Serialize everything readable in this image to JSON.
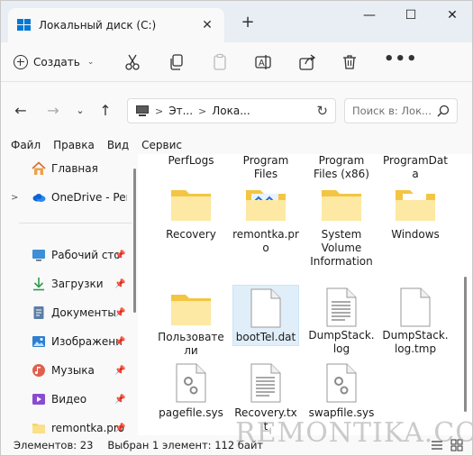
{
  "tab": {
    "title": "Локальный диск (C:)"
  },
  "window_controls": {
    "minimize": "—",
    "maximize": "☐",
    "close": "✕"
  },
  "toolbar": {
    "create_label": "Создать",
    "more_label": "•••"
  },
  "address": {
    "crumbs": [
      "Эт...",
      "Лока..."
    ]
  },
  "search": {
    "placeholder": "Поиск в: Лок..."
  },
  "menu": [
    "Файл",
    "Правка",
    "Вид",
    "Сервис"
  ],
  "nav": {
    "items": [
      {
        "label": "Главная",
        "icon": "home-icon"
      },
      {
        "label": "OneDrive - Perso",
        "icon": "onedrive-icon"
      },
      {
        "label": "Рабочий сто",
        "icon": "desktop-icon"
      },
      {
        "label": "Загрузки",
        "icon": "download-icon"
      },
      {
        "label": "Документы",
        "icon": "documents-icon"
      },
      {
        "label": "Изображени",
        "icon": "pictures-icon"
      },
      {
        "label": "Музыка",
        "icon": "music-icon"
      },
      {
        "label": "Видео",
        "icon": "video-icon"
      },
      {
        "label": "remontka.pro",
        "icon": "folder-icon"
      }
    ]
  },
  "files": {
    "row0": [
      "PerfLogs",
      "Program Files",
      "Program Files (x86)",
      "ProgramData"
    ],
    "row1": [
      "Recovery",
      "remontka.pro",
      "System Volume Information",
      "Windows"
    ],
    "row2": [
      "Пользователи",
      "bootTel.dat",
      "DumpStack.log",
      "DumpStack.log.tmp"
    ],
    "row3": [
      "pagefile.sys",
      "Recovery.txt",
      "swapfile.sys"
    ]
  },
  "status": {
    "count": "Элементов: 23",
    "selected": "Выбран 1 элемент: 112 байт"
  },
  "watermark": "REMONTIKA.COM",
  "colors": {
    "folder": "#f8d462",
    "accent": "#0067c0",
    "onedrive": "#0a64d6"
  }
}
